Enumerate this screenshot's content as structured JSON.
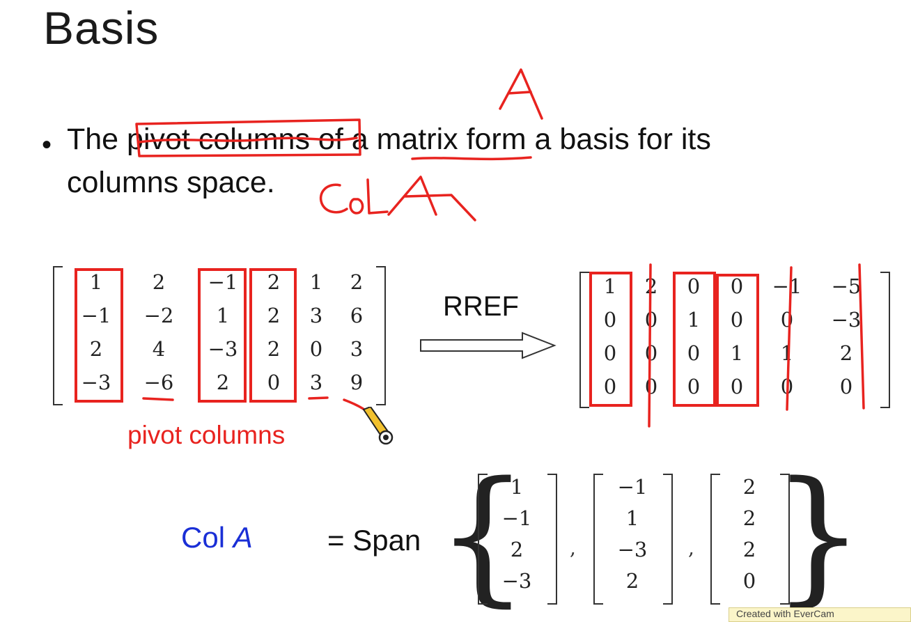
{
  "title": "Basis",
  "bullet": {
    "line1_parts": [
      "The ",
      "pivot columns",
      " of a matrix form a basis for its"
    ],
    "line2": "columns space."
  },
  "handwriting": {
    "matrix_letter": "A",
    "col_a": "ColA"
  },
  "matrix_left": {
    "rows": [
      [
        "1",
        "2",
        "−1",
        "2",
        "1",
        "2"
      ],
      [
        "−1",
        "−2",
        "1",
        "2",
        "3",
        "6"
      ],
      [
        "2",
        "4",
        "−3",
        "2",
        "0",
        "3"
      ],
      [
        "−3",
        "−6",
        "2",
        "0",
        "3",
        "9"
      ]
    ]
  },
  "rref_label": "RREF",
  "matrix_right": {
    "rows": [
      [
        "1",
        "2",
        "0",
        "0",
        "−1",
        "−5"
      ],
      [
        "0",
        "0",
        "1",
        "0",
        "0",
        "−3"
      ],
      [
        "0",
        "0",
        "0",
        "1",
        "1",
        "2"
      ],
      [
        "0",
        "0",
        "0",
        "0",
        "0",
        "0"
      ]
    ]
  },
  "pivot_label": "pivot columns",
  "col_space": {
    "label_prefix": "Col ",
    "label_var": "A",
    "equals_span": "= Span",
    "vectors": [
      [
        "1",
        "−1",
        "2",
        "−3"
      ],
      [
        "−1",
        "1",
        "−3",
        "2"
      ],
      [
        "2",
        "2",
        "2",
        "0"
      ]
    ],
    "separator": ","
  },
  "footer": "Created with EverCam",
  "colors": {
    "annotation_red": "#e8231f",
    "col_blue": "#1a2fd6"
  },
  "icons": [
    "pencil-cursor-icon"
  ]
}
